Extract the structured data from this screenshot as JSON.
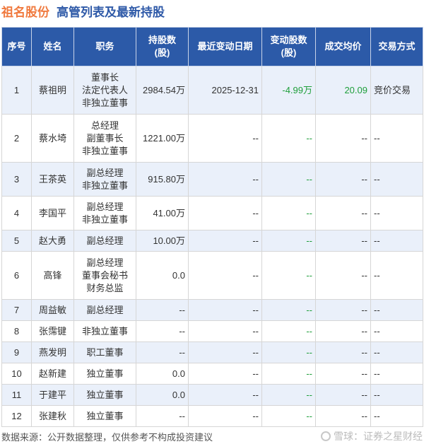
{
  "header": {
    "company": "祖名股份",
    "subtitle": "高管列表及最新持股"
  },
  "table": {
    "columns": [
      "序号",
      "姓名",
      "职务",
      "持股数\n(股)",
      "最近变动日期",
      "变动股数\n(股)",
      "成交均价",
      "交易方式"
    ],
    "rows": [
      {
        "idx": "1",
        "name": "蔡祖明",
        "positions": [
          "董事长",
          "法定代表人",
          "非独立董事"
        ],
        "shares": "2984.54万",
        "date": "2025-12-31",
        "change": "-4.99万",
        "price": "20.09",
        "method": "竞价交易"
      },
      {
        "idx": "2",
        "name": "蔡水埼",
        "positions": [
          "总经理",
          "副董事长",
          "非独立董事"
        ],
        "shares": "1221.00万",
        "date": "--",
        "change": "--",
        "price": "--",
        "method": "--"
      },
      {
        "idx": "3",
        "name": "王茶英",
        "positions": [
          "副总经理",
          "非独立董事"
        ],
        "shares": "915.80万",
        "date": "--",
        "change": "--",
        "price": "--",
        "method": "--"
      },
      {
        "idx": "4",
        "name": "李国平",
        "positions": [
          "副总经理",
          "非独立董事"
        ],
        "shares": "41.00万",
        "date": "--",
        "change": "--",
        "price": "--",
        "method": "--"
      },
      {
        "idx": "5",
        "name": "赵大勇",
        "positions": [
          "副总经理"
        ],
        "shares": "10.00万",
        "date": "--",
        "change": "--",
        "price": "--",
        "method": "--"
      },
      {
        "idx": "6",
        "name": "高锋",
        "positions": [
          "副总经理",
          "董事会秘书",
          "财务总监"
        ],
        "shares": "0.0",
        "date": "--",
        "change": "--",
        "price": "--",
        "method": "--"
      },
      {
        "idx": "7",
        "name": "周益敏",
        "positions": [
          "副总经理"
        ],
        "shares": "--",
        "date": "--",
        "change": "--",
        "price": "--",
        "method": "--"
      },
      {
        "idx": "8",
        "name": "张霈键",
        "positions": [
          "非独立董事"
        ],
        "shares": "--",
        "date": "--",
        "change": "--",
        "price": "--",
        "method": "--"
      },
      {
        "idx": "9",
        "name": "燕发明",
        "positions": [
          "职工董事"
        ],
        "shares": "--",
        "date": "--",
        "change": "--",
        "price": "--",
        "method": "--"
      },
      {
        "idx": "10",
        "name": "赵新建",
        "positions": [
          "独立董事"
        ],
        "shares": "0.0",
        "date": "--",
        "change": "--",
        "price": "--",
        "method": "--"
      },
      {
        "idx": "11",
        "name": "于建平",
        "positions": [
          "独立董事"
        ],
        "shares": "0.0",
        "date": "--",
        "change": "--",
        "price": "--",
        "method": "--"
      },
      {
        "idx": "12",
        "name": "张建秋",
        "positions": [
          "独立董事"
        ],
        "shares": "--",
        "date": "--",
        "change": "--",
        "price": "--",
        "method": "--"
      }
    ]
  },
  "footer": {
    "source": "数据来源：公开数据整理，仅供参考不构成投资建议",
    "brand": "雪球：证券之星财经",
    "brand_icon": "snowball-icon"
  },
  "watermark": "证券之星",
  "colors": {
    "company": "#f07a3f",
    "subtitle": "#2f5aa8",
    "header_bg": "#2c5aa8",
    "row_alt": "#eaf0fa",
    "change": "#1e9e3a"
  }
}
